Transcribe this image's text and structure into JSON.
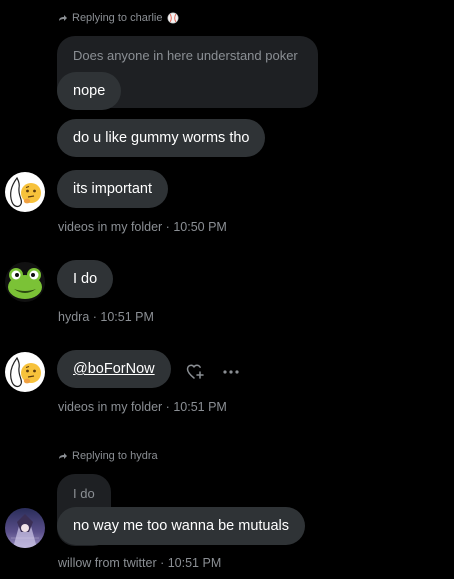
{
  "colors": {
    "bubble": "#2f3336",
    "quoted": "#1e2023",
    "meta": "#8b8f94",
    "text": "#ffffff",
    "background": "#000000"
  },
  "messages": [
    {
      "reply_to": "Replying to charlie",
      "reply_emoji_icon": "baseball-icon",
      "quoted_text": "Does anyone in here understand poker",
      "text": "nope"
    },
    {
      "text": "do u like gummy worms tho"
    },
    {
      "text": "its important",
      "meta": "videos in my folder · 10:50 PM",
      "avatar_icon": "thinking-face-icon"
    },
    {
      "text": "I do",
      "meta": "hydra · 10:51 PM",
      "avatar_icon": "frog-icon"
    },
    {
      "text": "@boForNow",
      "meta": "videos in my folder · 10:51 PM",
      "avatar_icon": "thinking-face-icon",
      "actions": [
        "add-reaction-icon",
        "more-icon"
      ]
    },
    {
      "reply_to": "Replying to hydra",
      "quoted_text": "I do",
      "text": "no way me too wanna be mutuals",
      "meta": "willow from twitter · 10:51 PM",
      "avatar_icon": "anime-avatar-icon"
    }
  ]
}
